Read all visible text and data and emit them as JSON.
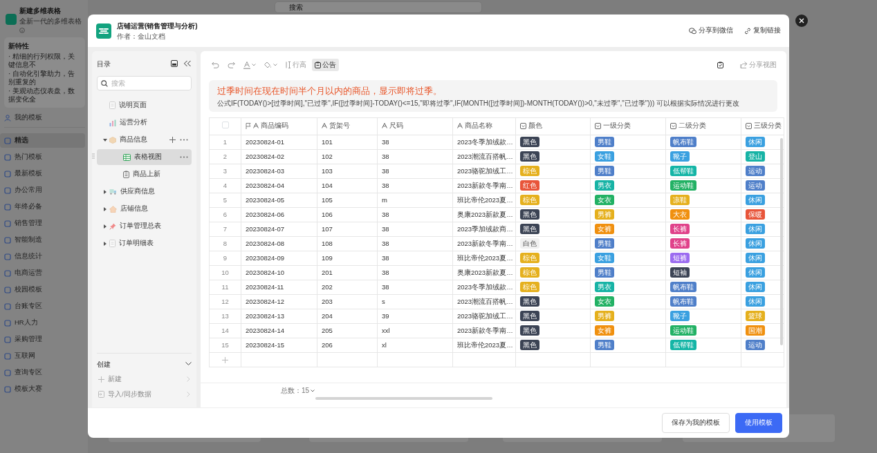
{
  "background": {
    "app": {
      "title": "新建多维表格",
      "subtitle": "全新一代的多维表格"
    },
    "features": {
      "title": "新特性",
      "lines": [
        "· 精细的行列权限，关键信息不",
        "· 自动化引擎助力，告别重复的",
        "· 美观动态仪表盘，数据变化全"
      ]
    },
    "search": {
      "placeholder": "搜索"
    },
    "my_templates": {
      "label": "我的模板"
    },
    "categories": [
      {
        "label": "精选",
        "selected": true
      },
      {
        "label": "热门模板",
        "selected": false
      },
      {
        "label": "最新模板",
        "selected": false
      },
      {
        "label": "办公常用",
        "selected": false
      },
      {
        "label": "年终必备",
        "selected": false
      },
      {
        "label": "销售管理",
        "selected": false
      },
      {
        "label": "智能制造",
        "selected": false
      },
      {
        "label": "信息统计",
        "selected": false
      },
      {
        "label": "电商运营",
        "selected": false
      },
      {
        "label": "校园模板",
        "selected": false
      },
      {
        "label": "台账专区",
        "selected": false
      },
      {
        "label": "HR人力",
        "selected": false
      },
      {
        "label": "采购管理",
        "selected": false
      },
      {
        "label": "互联网",
        "selected": false
      },
      {
        "label": "查询专区",
        "selected": false
      },
      {
        "label": "模板大赛",
        "selected": false
      }
    ]
  },
  "modal": {
    "title": "店铺运营(销售管理与分析)",
    "author": "作者：金山文档",
    "header_actions": [
      {
        "kind": "wechat",
        "label": "分享到微信"
      },
      {
        "kind": "link",
        "label": "复制链接"
      }
    ],
    "sidebar": {
      "title": "目录",
      "search": {
        "placeholder": "搜索"
      },
      "tree": [
        {
          "kind": "doc",
          "label": "说明页面",
          "selected": false
        },
        {
          "kind": "chart",
          "label": "运营分析",
          "selected": false
        },
        {
          "kind": "box",
          "label": "商品信息",
          "selected": false,
          "expanded": true,
          "children": [
            {
              "kind": "grid",
              "label": "表格视图",
              "selected": true
            },
            {
              "kind": "form",
              "label": "商品上新",
              "selected": false
            }
          ]
        },
        {
          "kind": "supplier",
          "label": "供应商信息",
          "selected": false,
          "expanded": false
        },
        {
          "kind": "house",
          "label": "店铺信息",
          "selected": false,
          "expanded": false
        },
        {
          "kind": "pin",
          "label": "订单管理总表",
          "selected": false,
          "expanded": false
        },
        {
          "kind": "doc",
          "label": "订单明细表",
          "selected": false,
          "expanded": false
        }
      ],
      "create": {
        "title": "创建",
        "items": [
          {
            "kind": "new",
            "label": "新建",
            "disabled": true
          },
          {
            "kind": "import",
            "label": "导入/同步数据",
            "disabled": true
          }
        ]
      }
    },
    "toolbar": [
      {
        "kind": "undo",
        "disabled": true
      },
      {
        "kind": "redo",
        "disabled": true
      },
      {
        "kind": "text-color"
      },
      {
        "kind": "fill-color"
      },
      {
        "kind": "row-height",
        "label": "行高",
        "selected": false
      },
      {
        "kind": "announcement",
        "label": "公告",
        "selected": true
      }
    ],
    "toolbar_right": [
      {
        "kind": "clipboard"
      },
      {
        "kind": "share",
        "label": "分享视图",
        "disabled": true
      }
    ],
    "announcement": {
      "title": "过季时间在现在时间半个月以内的商品，显示即将过季。",
      "formula": "公式IF(TODAY()>[过季时间],\"已过季\",IF([过季时间]-TODAY()<=15,\"即将过季\",IF(MONTH([过季时间])-MONTH(TODAY())>0,\"未过季\",\"已过季\"))) 可以根据实际情况进行更改"
    },
    "table": {
      "select_all": {
        "checked": false
      },
      "columns": [
        {
          "label": "商品编码",
          "kind": "text",
          "primary": true
        },
        {
          "label": "货架号",
          "kind": "text",
          "primary": false
        },
        {
          "label": "尺码",
          "kind": "text",
          "primary": false
        },
        {
          "label": "商品名称",
          "kind": "text",
          "primary": false
        },
        {
          "label": "颜色",
          "kind": "select",
          "primary": false
        },
        {
          "label": "一级分类",
          "kind": "select",
          "primary": false
        },
        {
          "label": "二级分类",
          "kind": "select",
          "primary": false
        },
        {
          "label": "三级分类",
          "kind": "select",
          "primary": false
        }
      ],
      "rows": [
        {
          "num": "1",
          "cells": [
            "20230824-01",
            "101",
            "38",
            "2023冬季加绒款…",
            {
              "label": "黑色",
              "color": "#3b4354"
            },
            {
              "label": "男鞋",
              "color": "#4f7fc9"
            },
            {
              "label": "帆布鞋",
              "color": "#4f7fc9"
            },
            {
              "label": "休闲",
              "color": "#3aa0e0"
            }
          ]
        },
        {
          "num": "2",
          "cells": [
            "20230824-02",
            "102",
            "38",
            "2023潮流百搭帆…",
            {
              "label": "黑色",
              "color": "#3b4354"
            },
            {
              "label": "女鞋",
              "color": "#3aa0e0"
            },
            {
              "label": "靴子",
              "color": "#3aa0e0"
            },
            {
              "label": "登山",
              "color": "#17b3a5"
            }
          ]
        },
        {
          "num": "3",
          "cells": [
            "20230824-03",
            "103",
            "38",
            "2023骆驼加绒工…",
            {
              "label": "棕色",
              "color": "#e5b01d"
            },
            {
              "label": "男鞋",
              "color": "#4f7fc9"
            },
            {
              "label": "低帮鞋",
              "color": "#14b5a6"
            },
            {
              "label": "运动",
              "color": "#4f7fc9"
            }
          ]
        },
        {
          "num": "4",
          "cells": [
            "20230824-04",
            "104",
            "38",
            "2023新款冬季南…",
            {
              "label": "红色",
              "color": "#e8553a"
            },
            {
              "label": "男衣",
              "color": "#17b3a5"
            },
            {
              "label": "运动鞋",
              "color": "#22b164"
            },
            {
              "label": "运动",
              "color": "#4f7fc9"
            }
          ]
        },
        {
          "num": "5",
          "cells": [
            "20230824-05",
            "105",
            "m",
            "班比帝伦2023夏…",
            {
              "label": "棕色",
              "color": "#e5b01d"
            },
            {
              "label": "女衣",
              "color": "#22b164"
            },
            {
              "label": "凉鞋",
              "color": "#e5b01d"
            },
            {
              "label": "休闲",
              "color": "#3aa0e0"
            }
          ]
        },
        {
          "num": "6",
          "cells": [
            "20230824-06",
            "106",
            "38",
            "奥康2023新款夏…",
            {
              "label": "黑色",
              "color": "#3b4354"
            },
            {
              "label": "男裤",
              "color": "#e5b01d"
            },
            {
              "label": "大衣",
              "color": "#f0900f"
            },
            {
              "label": "保暖",
              "color": "#e8553a"
            }
          ]
        },
        {
          "num": "7",
          "cells": [
            "20230824-07",
            "107",
            "38",
            "2023季加绒款商…",
            {
              "label": "黑色",
              "color": "#3b4354"
            },
            {
              "label": "女裤",
              "color": "#f0900f"
            },
            {
              "label": "长裤",
              "color": "#e0428a"
            },
            {
              "label": "休闲",
              "color": "#3aa0e0"
            }
          ]
        },
        {
          "num": "8",
          "cells": [
            "20230824-08",
            "108",
            "38",
            "2023新款冬季南…",
            {
              "label": "白色",
              "color": "#f0f0f0"
            },
            {
              "label": "男鞋",
              "color": "#4f7fc9"
            },
            {
              "label": "长裤",
              "color": "#e0428a"
            },
            {
              "label": "休闲",
              "color": "#3aa0e0"
            }
          ]
        },
        {
          "num": "9",
          "cells": [
            "20230824-09",
            "109",
            "38",
            "班比帝伦2023夏…",
            {
              "label": "棕色",
              "color": "#e5b01d"
            },
            {
              "label": "女鞋",
              "color": "#3aa0e0"
            },
            {
              "label": "短裤",
              "color": "#9b6cf0"
            },
            {
              "label": "休闲",
              "color": "#3aa0e0"
            }
          ]
        },
        {
          "num": "10",
          "cells": [
            "20230824-10",
            "201",
            "38",
            "奥康2023新款夏…",
            {
              "label": "棕色",
              "color": "#e5b01d"
            },
            {
              "label": "男鞋",
              "color": "#4f7fc9"
            },
            {
              "label": "短袖",
              "color": "#3b4354"
            },
            {
              "label": "休闲",
              "color": "#3aa0e0"
            }
          ]
        },
        {
          "num": "11",
          "cells": [
            "20230824-11",
            "202",
            "38",
            "2023冬季加绒款…",
            {
              "label": "棕色",
              "color": "#e5b01d"
            },
            {
              "label": "男衣",
              "color": "#17b3a5"
            },
            {
              "label": "帆布鞋",
              "color": "#4f7fc9"
            },
            {
              "label": "休闲",
              "color": "#3aa0e0"
            }
          ]
        },
        {
          "num": "12",
          "cells": [
            "20230824-12",
            "203",
            "s",
            "2023潮流百搭帆…",
            {
              "label": "黑色",
              "color": "#3b4354"
            },
            {
              "label": "女衣",
              "color": "#22b164"
            },
            {
              "label": "帆布鞋",
              "color": "#4f7fc9"
            },
            {
              "label": "休闲",
              "color": "#3aa0e0"
            }
          ]
        },
        {
          "num": "13",
          "cells": [
            "20230824-13",
            "204",
            "39",
            "2023骆驼加绒工…",
            {
              "label": "黑色",
              "color": "#3b4354"
            },
            {
              "label": "男裤",
              "color": "#e5b01d"
            },
            {
              "label": "靴子",
              "color": "#3aa0e0"
            },
            {
              "label": "篮球",
              "color": "#e5b01d"
            }
          ]
        },
        {
          "num": "14",
          "cells": [
            "20230824-14",
            "205",
            "xxl",
            "2023新款冬季南…",
            {
              "label": "黑色",
              "color": "#3b4354"
            },
            {
              "label": "女裤",
              "color": "#f0900f"
            },
            {
              "label": "运动鞋",
              "color": "#22b164"
            },
            {
              "label": "国潮",
              "color": "#f0900f"
            }
          ]
        },
        {
          "num": "15",
          "cells": [
            "20230824-15",
            "206",
            "xl",
            "班比帝伦2023夏…",
            {
              "label": "黑色",
              "color": "#3b4354"
            },
            {
              "label": "男鞋",
              "color": "#4f7fc9"
            },
            {
              "label": "低帮鞋",
              "color": "#14b5a6"
            },
            {
              "label": "运动",
              "color": "#4f7fc9"
            }
          ]
        }
      ],
      "total": "总数：15"
    },
    "footer_buttons": [
      {
        "kind": "secondary",
        "label": "保存为我的模板"
      },
      {
        "kind": "primary",
        "label": "使用模板"
      }
    ]
  }
}
